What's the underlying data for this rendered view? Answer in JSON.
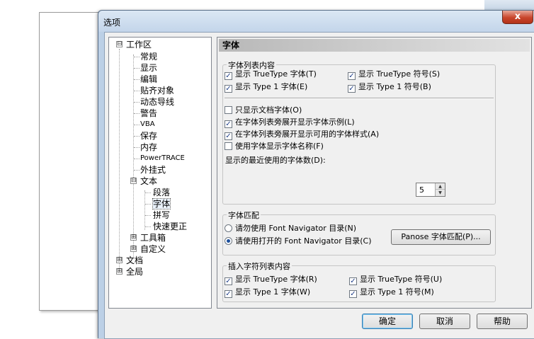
{
  "window": {
    "title": "选项",
    "close_label": "x"
  },
  "tree": {
    "items": [
      {
        "label": "工作区",
        "toggle": "⊟"
      },
      {
        "label": "常规"
      },
      {
        "label": "显示"
      },
      {
        "label": "编辑"
      },
      {
        "label": "贴齐对象"
      },
      {
        "label": "动态导线"
      },
      {
        "label": "警告"
      },
      {
        "label": "VBA"
      },
      {
        "label": "保存"
      },
      {
        "label": "内存"
      },
      {
        "label": "PowerTRACE"
      },
      {
        "label": "外挂式"
      },
      {
        "label": "文本",
        "toggle": "⊟"
      },
      {
        "label": "段落"
      },
      {
        "label": "字体"
      },
      {
        "label": "拼写"
      },
      {
        "label": "快速更正"
      },
      {
        "label": "工具箱",
        "toggle": "⊞"
      },
      {
        "label": "自定义",
        "toggle": "⊞"
      },
      {
        "label": "文档",
        "toggle": "⊞"
      },
      {
        "label": "全局",
        "toggle": "⊞"
      }
    ]
  },
  "panel": {
    "header": "字体",
    "group1": {
      "title": "字体列表内容",
      "show_truetype_fonts": "显示 TrueType 字体(T)",
      "show_truetype_symbols": "显示 TrueType 符号(S)",
      "show_type1_fonts": "显示 Type 1 字体(E)",
      "show_type1_symbols": "显示 Type 1 符号(B)",
      "only_doc_fonts": "只显示文档字体(O)",
      "show_samples": "在字体列表旁展开显示字体示例(L)",
      "show_styles": "在字体列表旁展开显示可用的字体样式(A)",
      "use_font_names": "使用字体显示字体名称(F)",
      "recent_label": "显示的最近使用的字体数(D):",
      "recent_value": "5",
      "checked": "✓"
    },
    "group2": {
      "title": "字体匹配",
      "radio_off": "请勿使用 Font Navigator 目录(N)",
      "radio_on": "请使用打开的 Font Navigator 目录(C)",
      "panose_button": "Panose 字体匹配(P)..."
    },
    "group3": {
      "title": "插入字符列表内容",
      "show_truetype_fonts": "显示 TrueType 字体(R)",
      "show_truetype_symbols": "显示 TrueType 符号(U)",
      "show_type1_fonts": "显示 Type 1 字体(W)",
      "show_type1_symbols": "显示 Type 1 符号(M)"
    }
  },
  "buttons": {
    "ok": "确定",
    "cancel": "取消",
    "help": "帮助"
  }
}
